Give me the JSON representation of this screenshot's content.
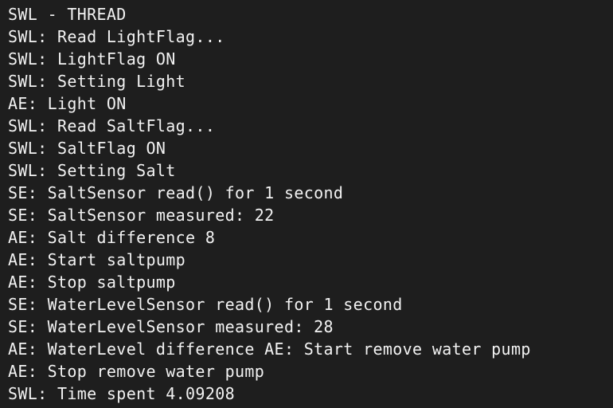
{
  "terminal": {
    "lines": [
      "SWL - THREAD",
      "SWL: Read LightFlag...",
      "SWL: LightFlag ON",
      "SWL: Setting Light",
      "AE: Light ON",
      "SWL: Read SaltFlag...",
      "SWL: SaltFlag ON",
      "SWL: Setting Salt",
      "SE: SaltSensor read() for 1 second",
      "SE: SaltSensor measured: 22",
      "AE: Salt difference 8",
      "AE: Start saltpump",
      "AE: Stop saltpump",
      "SE: WaterLevelSensor read() for 1 second",
      "SE: WaterLevelSensor measured: 28",
      "AE: WaterLevel difference AE: Start remove water pump",
      "AE: Stop remove water pump",
      "SWL: Time spent 4.09208"
    ],
    "colors": {
      "background": "#1e1e1e",
      "text": "#f2f2f2"
    }
  }
}
